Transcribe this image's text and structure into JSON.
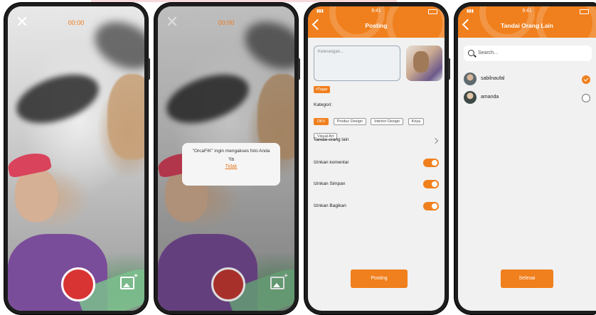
{
  "screen1": {
    "timer": "00:00"
  },
  "screen2": {
    "timer": "00:00",
    "dialog": {
      "message": "\"OrcaFIK\" ingin mengakses foto Anda",
      "yes": "Ya",
      "no": "Tidak"
    }
  },
  "screen3": {
    "time": "9:41",
    "title": "Posting",
    "description_placeholder": "Keterangan...",
    "tag_label": "#Tagar",
    "category_label": "Kategori:",
    "categories": [
      "DKV",
      "Produc Design",
      "Interior Design",
      "Kriya",
      "Visual Art"
    ],
    "tag_people_label": "Tandai orang lain",
    "settings": [
      "Izinkan komentar",
      "Izinkan Simpan",
      "Izinkan Bagikan"
    ],
    "submit_label": "Posting"
  },
  "screen4": {
    "time": "9:41",
    "title": "Tandai Orang Lain",
    "search_placeholder": "Search...",
    "users": [
      {
        "name": "sabilnaufal",
        "selected": true
      },
      {
        "name": "amanda",
        "selected": false
      }
    ],
    "submit_label": "Selesai"
  },
  "colors": {
    "accent": "#f07f1d",
    "shutter": "#d93434"
  }
}
